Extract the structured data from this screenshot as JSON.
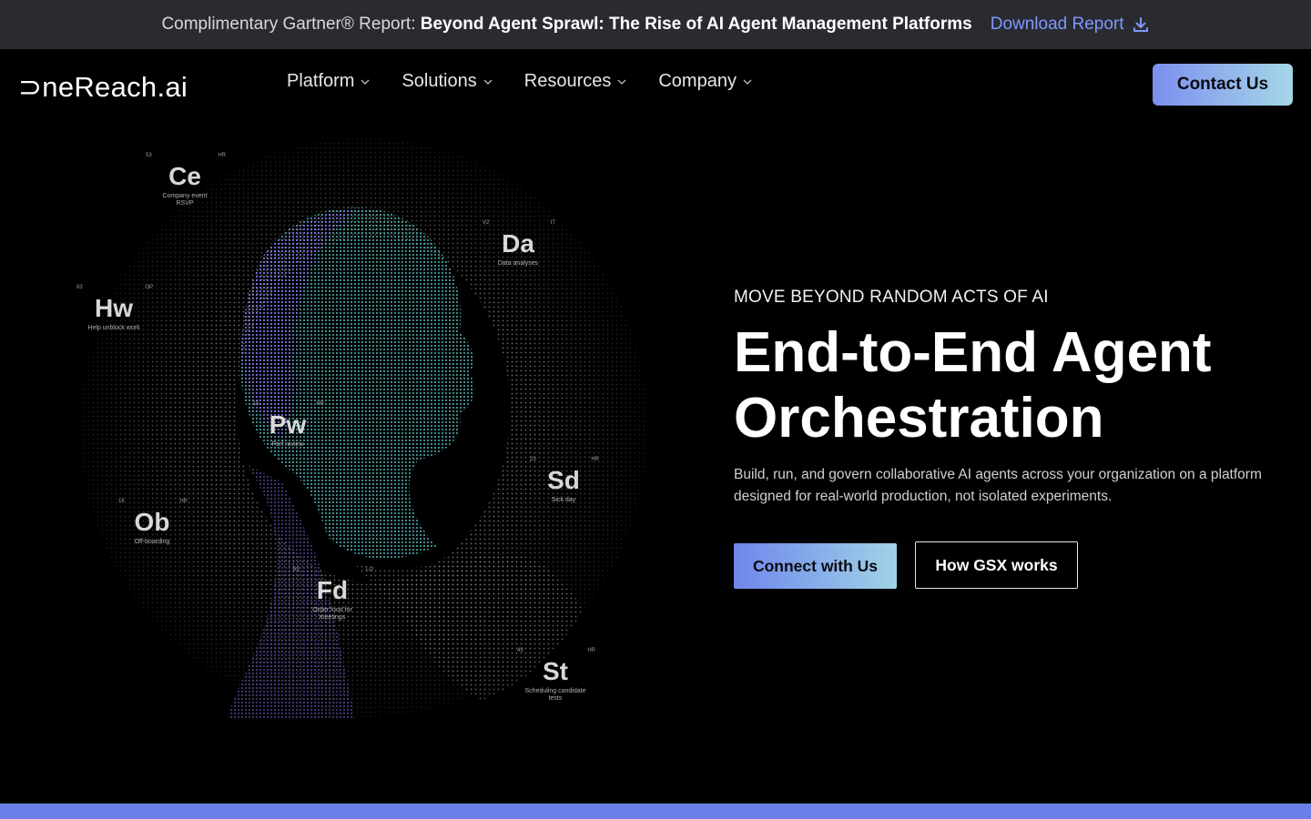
{
  "announcement": {
    "lead": "Complimentary Gartner® Report:",
    "title": "Beyond Agent Sprawl: The Rise of AI Agent Management Platforms",
    "link": "Download Report",
    "link_icon": "download-icon",
    "link_color": "#7f97ff"
  },
  "header": {
    "logo": "⊃neReach.ai",
    "nav": [
      {
        "label": "Platform",
        "icon": "chevron-down-icon"
      },
      {
        "label": "Solutions",
        "icon": "chevron-down-icon"
      },
      {
        "label": "Resources",
        "icon": "chevron-down-icon"
      },
      {
        "label": "Company",
        "icon": "chevron-down-icon"
      }
    ],
    "contact": "Contact Us"
  },
  "art": {
    "chips": [
      {
        "num": "53",
        "grp": "HR",
        "sym": "Ce",
        "cap": "Company event RSVP"
      },
      {
        "num": "V2",
        "grp": "IT",
        "sym": "Da",
        "cap": "Data analyses"
      },
      {
        "num": "83",
        "grp": "OP",
        "sym": "Hw",
        "cap": "Help unblock work"
      },
      {
        "num": "15",
        "grp": "HR",
        "sym": "Pw",
        "cap": "Perf review"
      },
      {
        "num": "23",
        "grp": "HR",
        "sym": "Sd",
        "cap": "Sick day"
      },
      {
        "num": "16",
        "grp": "HR",
        "sym": "Ob",
        "cap": "Off-boarding"
      },
      {
        "num": "63",
        "grp": "LO",
        "sym": "Fd",
        "cap": "Order food for meetings"
      },
      {
        "num": "43",
        "grp": "HR",
        "sym": "St",
        "cap": "Scheduling candidate tests"
      }
    ],
    "colors": {
      "purple": "#8a6cf0",
      "teal": "#5fd4d8",
      "dots": "#8a877c"
    }
  },
  "hero": {
    "eyebrow": "MOVE BEYOND RANDOM ACTS OF AI",
    "headline_1": "End-to-End Agent",
    "headline_2": "Orchestration",
    "description": "Build, run, and govern collaborative AI agents across your organization on a platform designed for real-world production, not isolated experiments.",
    "primary_cta": "Connect with Us",
    "secondary_cta": "How GSX works"
  },
  "colors": {
    "accent_start": "#6f86ec",
    "accent_end": "#9fd3e6",
    "bottom_bar": "#6a80e8",
    "announcement_bg": "#2a2b30"
  }
}
